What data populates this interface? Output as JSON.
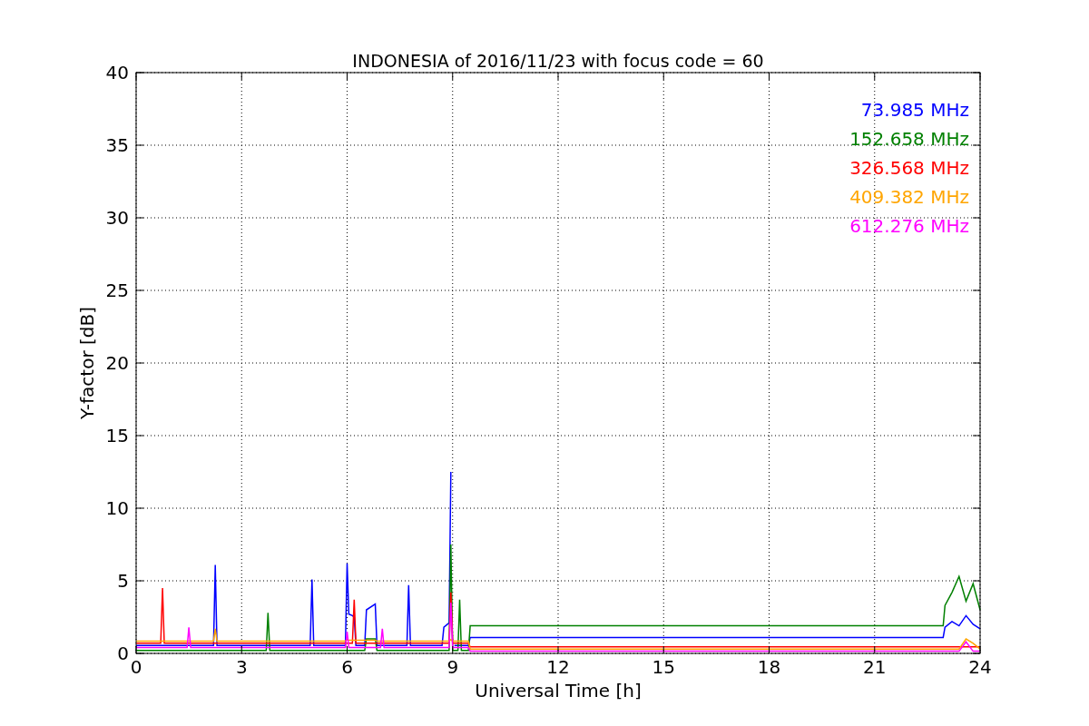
{
  "chart": {
    "chart_data": {
      "type": "line",
      "title": "INDONESIA of 2016/11/23 with focus code = 60",
      "xlabel": "Universal Time [h]",
      "ylabel": "Y-factor [dB]",
      "x": [
        0,
        0.7,
        0.75,
        0.8,
        1.45,
        1.5,
        1.55,
        2.2,
        2.25,
        2.3,
        3.7,
        3.75,
        3.8,
        4.95,
        5.0,
        5.05,
        5.95,
        6.0,
        6.05,
        6.15,
        6.2,
        6.25,
        6.5,
        6.55,
        6.8,
        6.85,
        6.95,
        7.0,
        7.05,
        7.7,
        7.75,
        7.8,
        8.7,
        8.75,
        8.9,
        8.95,
        9.0,
        9.05,
        9.15,
        9.2,
        9.25,
        9.45,
        9.5,
        22.95,
        23.0,
        23.2,
        23.4,
        23.6,
        23.8,
        24.0
      ],
      "series": [
        {
          "name": "73.985 MHz",
          "color": "#0000ff",
          "values": [
            0.55,
            0.55,
            0.55,
            0.55,
            0.55,
            0.55,
            0.55,
            0.55,
            6.1,
            0.55,
            0.55,
            0.55,
            0.55,
            0.55,
            5.1,
            0.55,
            0.55,
            6.2,
            2.7,
            2.6,
            2.5,
            0.55,
            0.55,
            3.0,
            3.4,
            0.55,
            0.55,
            0.55,
            0.55,
            0.55,
            4.7,
            0.55,
            0.55,
            1.8,
            2.1,
            12.5,
            null,
            0.55,
            0.55,
            0.55,
            0.55,
            0.55,
            1.1,
            1.1,
            1.8,
            2.2,
            1.9,
            2.6,
            2.0,
            1.7
          ]
        },
        {
          "name": "152.658 MHz",
          "color": "#008000",
          "values": [
            0.2,
            0.2,
            0.2,
            0.2,
            0.2,
            0.2,
            0.2,
            0.2,
            0.2,
            0.2,
            0.2,
            2.8,
            0.2,
            0.2,
            0.2,
            0.2,
            0.2,
            0.2,
            0.2,
            0.2,
            0.2,
            0.2,
            0.2,
            1.0,
            1.0,
            0.2,
            0.2,
            0.2,
            0.2,
            0.2,
            0.2,
            0.2,
            0.2,
            0.2,
            0.2,
            7.5,
            0.2,
            0.2,
            0.2,
            3.7,
            0.2,
            0.2,
            1.9,
            1.9,
            3.3,
            4.2,
            5.3,
            3.6,
            4.8,
            3.0
          ]
        },
        {
          "name": "326.568 MHz",
          "color": "#ff0000",
          "values": [
            0.7,
            0.7,
            4.5,
            0.7,
            0.7,
            0.7,
            0.7,
            0.7,
            0.7,
            0.7,
            0.7,
            0.7,
            0.7,
            0.7,
            0.7,
            0.7,
            0.7,
            0.7,
            0.7,
            0.7,
            3.7,
            0.7,
            0.7,
            0.7,
            0.7,
            0.7,
            0.7,
            0.7,
            0.7,
            0.7,
            0.7,
            0.7,
            0.7,
            0.7,
            0.7,
            4.2,
            0.7,
            0.7,
            0.7,
            0.7,
            0.7,
            0.7,
            0.45,
            0.45,
            0.45,
            0.45,
            0.45,
            0.45,
            0.45,
            0.45
          ]
        },
        {
          "name": "409.382 MHz",
          "color": "#ffa500",
          "values": [
            0.85,
            0.85,
            0.85,
            0.85,
            0.85,
            0.85,
            0.85,
            0.85,
            1.7,
            0.85,
            0.85,
            0.85,
            0.85,
            0.85,
            0.85,
            0.85,
            0.85,
            0.95,
            0.9,
            0.9,
            0.9,
            0.9,
            0.9,
            0.9,
            0.9,
            0.85,
            0.85,
            0.85,
            0.85,
            0.85,
            0.85,
            0.85,
            0.85,
            0.85,
            0.85,
            0.95,
            0.85,
            0.85,
            0.85,
            0.85,
            0.85,
            0.85,
            0.3,
            0.3,
            0.3,
            0.3,
            0.3,
            1.0,
            0.7,
            0.3
          ]
        },
        {
          "name": "612.276 MHz",
          "color": "#ff00ff",
          "values": [
            0.4,
            0.4,
            0.4,
            0.4,
            0.4,
            1.8,
            0.4,
            0.4,
            0.4,
            0.4,
            0.4,
            0.4,
            0.4,
            0.4,
            0.4,
            0.4,
            0.4,
            1.5,
            0.4,
            0.4,
            0.4,
            0.4,
            0.4,
            0.4,
            0.4,
            0.4,
            0.4,
            1.7,
            0.4,
            0.4,
            0.4,
            0.4,
            0.4,
            0.4,
            0.4,
            3.5,
            0.4,
            0.4,
            0.4,
            0.4,
            0.4,
            0.4,
            0.15,
            0.15,
            0.15,
            0.15,
            0.15,
            0.8,
            0.15,
            0.15
          ]
        }
      ],
      "grid": true,
      "xlim": [
        0,
        24
      ],
      "ylim": [
        0,
        40
      ],
      "xticks": [
        0,
        3,
        6,
        9,
        12,
        15,
        18,
        21,
        24
      ],
      "yticks": [
        0,
        5,
        10,
        15,
        20,
        25,
        30,
        35,
        40
      ]
    }
  }
}
